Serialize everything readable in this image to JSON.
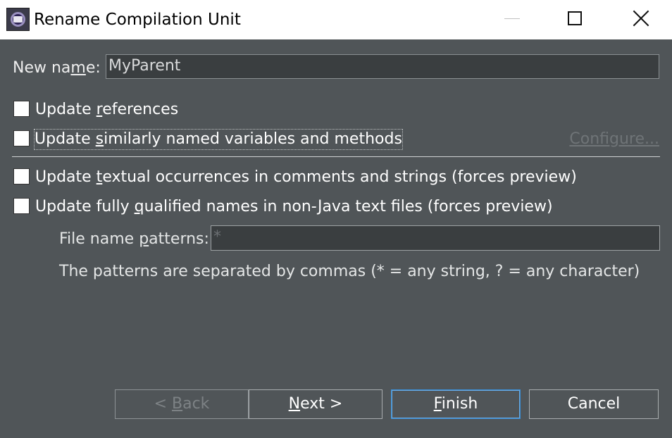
{
  "window": {
    "title": "Rename Compilation Unit"
  },
  "form": {
    "new_name_label_pre": "New na",
    "new_name_label_u": "m",
    "new_name_label_post": "e:",
    "new_name_value": "MyParent",
    "checkboxes": [
      {
        "pre": "Update ",
        "u": "r",
        "post": "eferences",
        "checked": false
      },
      {
        "pre": "Update ",
        "u": "s",
        "post": "imilarly named variables and methods",
        "checked": false
      },
      {
        "pre": "Update ",
        "u": "t",
        "post": "extual occurrences in comments and strings (forces preview)",
        "checked": false
      },
      {
        "pre": "Update fully ",
        "u": "q",
        "post": "ualified names in non-Java text files (forces preview)",
        "checked": false
      }
    ],
    "configure_label": "Configure...",
    "patterns_label_pre": "File name ",
    "patterns_label_u": "p",
    "patterns_label_post": "atterns:",
    "patterns_value": "*",
    "patterns_hint": "The patterns are separated by commas (* = any string, ? = any character)"
  },
  "buttons": {
    "back_pre": "< ",
    "back_u": "B",
    "back_post": "ack",
    "next_u": "N",
    "next_post": "ext >",
    "finish_u": "F",
    "finish_post": "inish",
    "cancel": "Cancel"
  },
  "colors": {
    "dialog_bg": "#505558",
    "titlebar_bg": "#ffffff",
    "default_button_border": "#3b8fd6"
  }
}
